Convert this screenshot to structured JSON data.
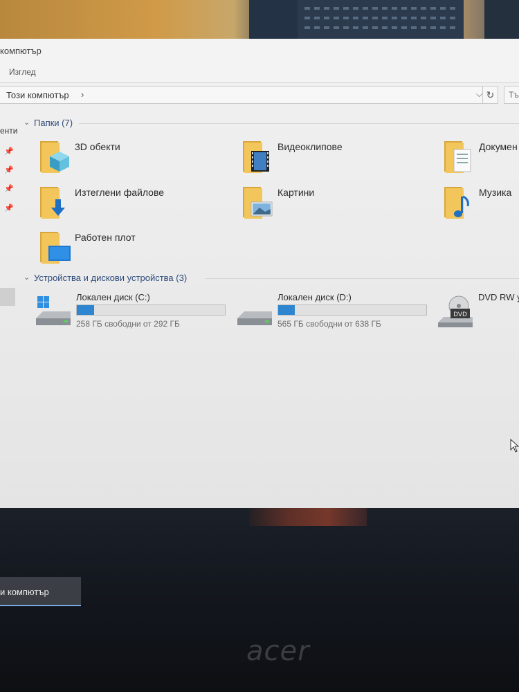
{
  "window": {
    "title": "компютър",
    "ribbon_tab": "Изглед"
  },
  "address": {
    "path": "Този компютър",
    "search_placeholder": "Тъ"
  },
  "navpane": {
    "fragment": "енти"
  },
  "folders": {
    "header": "Папки (7)",
    "items": [
      {
        "label": "3D обекти",
        "icon": "3d-objects-folder-icon"
      },
      {
        "label": "Видеоклипове",
        "icon": "videos-folder-icon"
      },
      {
        "label": "Докумен",
        "icon": "documents-folder-icon"
      },
      {
        "label": "Изтеглени файлове",
        "icon": "downloads-folder-icon"
      },
      {
        "label": "Картини",
        "icon": "pictures-folder-icon"
      },
      {
        "label": "Музика",
        "icon": "music-folder-icon"
      },
      {
        "label": "Работен плот",
        "icon": "desktop-folder-icon"
      }
    ]
  },
  "devices": {
    "header": "Устройства и дискови устройства (3)",
    "items": [
      {
        "label": "Локален диск (C:)",
        "free": "258 ГБ свободни от 292 ГБ",
        "used_fraction": 0.116
      },
      {
        "label": "Локален диск (D:)",
        "free": "565 ГБ свободни от 638 ГБ",
        "used_fraction": 0.114
      },
      {
        "label": "DVD RW у",
        "icon_text": "DVD"
      }
    ]
  },
  "taskbar": {
    "active_item": "и компютър"
  },
  "brand": "acer",
  "colors": {
    "accent": "#2e86d0",
    "group_header": "#2d4a7a"
  }
}
